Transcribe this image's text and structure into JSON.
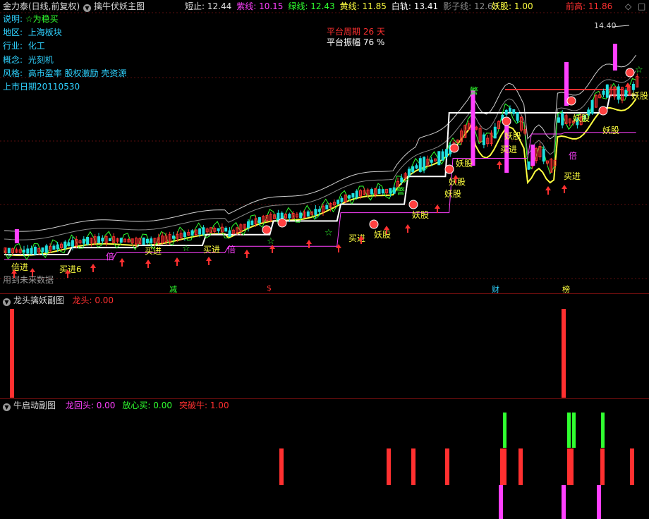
{
  "header": {
    "app": "金力泰(日线,前复权)",
    "main_title": "擒牛伏妖主图",
    "indicators": [
      {
        "label": "短止",
        "value": "12.44",
        "color": "#e0e0e0"
      },
      {
        "label": "紫线",
        "value": "10.15",
        "color": "#ff40ff"
      },
      {
        "label": "绿线",
        "value": "12.43",
        "color": "#30ff30"
      },
      {
        "label": "黄线",
        "value": "11.85",
        "color": "#ffff40"
      },
      {
        "label": "白轨",
        "value": "13.41",
        "color": "#ffffff"
      },
      {
        "label": "影子线",
        "value": "12.63",
        "color": "#8a8a8a"
      }
    ],
    "yao_label": "妖股",
    "yao_value": "1.00",
    "prev_high_label": "前高",
    "prev_high_value": "11.86",
    "controls": {
      "diamond": "◇",
      "square": "□"
    }
  },
  "info": {
    "desc_label": "说明",
    "desc_value": "☆为稳买",
    "region_label": "地区",
    "region_value": "上海板块",
    "industry_label": "行业",
    "industry_value": "化工",
    "concept_label": "概念",
    "concept_value": "光刻机",
    "style_label": "风格",
    "style_value": "高市盈率 股权激励 壳资源",
    "listing_label": "上市日期",
    "listing_value": "20110530"
  },
  "platform": {
    "cycle_label": "平台周期",
    "cycle_value": "26 天",
    "amp_label": "平台振幅",
    "amp_value": "76 %"
  },
  "price_peak": "14.40",
  "future_note": "用到未来数据",
  "chart_labels": {
    "buy": "买进",
    "buy_first": "买进6",
    "yao": "妖股",
    "bei": "倍",
    "jing": "警",
    "bei_first": "倍进"
  },
  "markers": {
    "m1": "减",
    "m2": "$",
    "m3": "财",
    "m4": "榜"
  },
  "panel1": {
    "title": "龙头擒妖副图",
    "label": "龙头",
    "value": "0.00"
  },
  "panel2": {
    "title": "牛启动副图",
    "items": [
      {
        "label": "龙回头",
        "value": "0.00",
        "color": "#ff40ff"
      },
      {
        "label": "放心买",
        "value": "0.00",
        "color": "#30ff30"
      },
      {
        "label": "突破牛",
        "value": "1.00",
        "color": "#ff3030"
      }
    ]
  },
  "colors": {
    "up": "#ff3030",
    "down": "#20e0e0",
    "magenta": "#ff40ff",
    "green": "#30ff30",
    "yellow": "#ffff40",
    "white": "#ffffff",
    "gray": "#8a8a8a"
  },
  "chart_data": {
    "type": "candlestick",
    "price_range": [
      8.0,
      14.6
    ],
    "peak_price": 14.4,
    "panel1_bars_x_index": [
      3,
      134
    ],
    "panel2_red_index": [
      67,
      92,
      98,
      106,
      119,
      124,
      142,
      147,
      150,
      150
    ],
    "panel2_green_index": [
      119,
      136,
      137,
      144
    ],
    "panel2_magenta_index": [
      119,
      134,
      143
    ]
  }
}
